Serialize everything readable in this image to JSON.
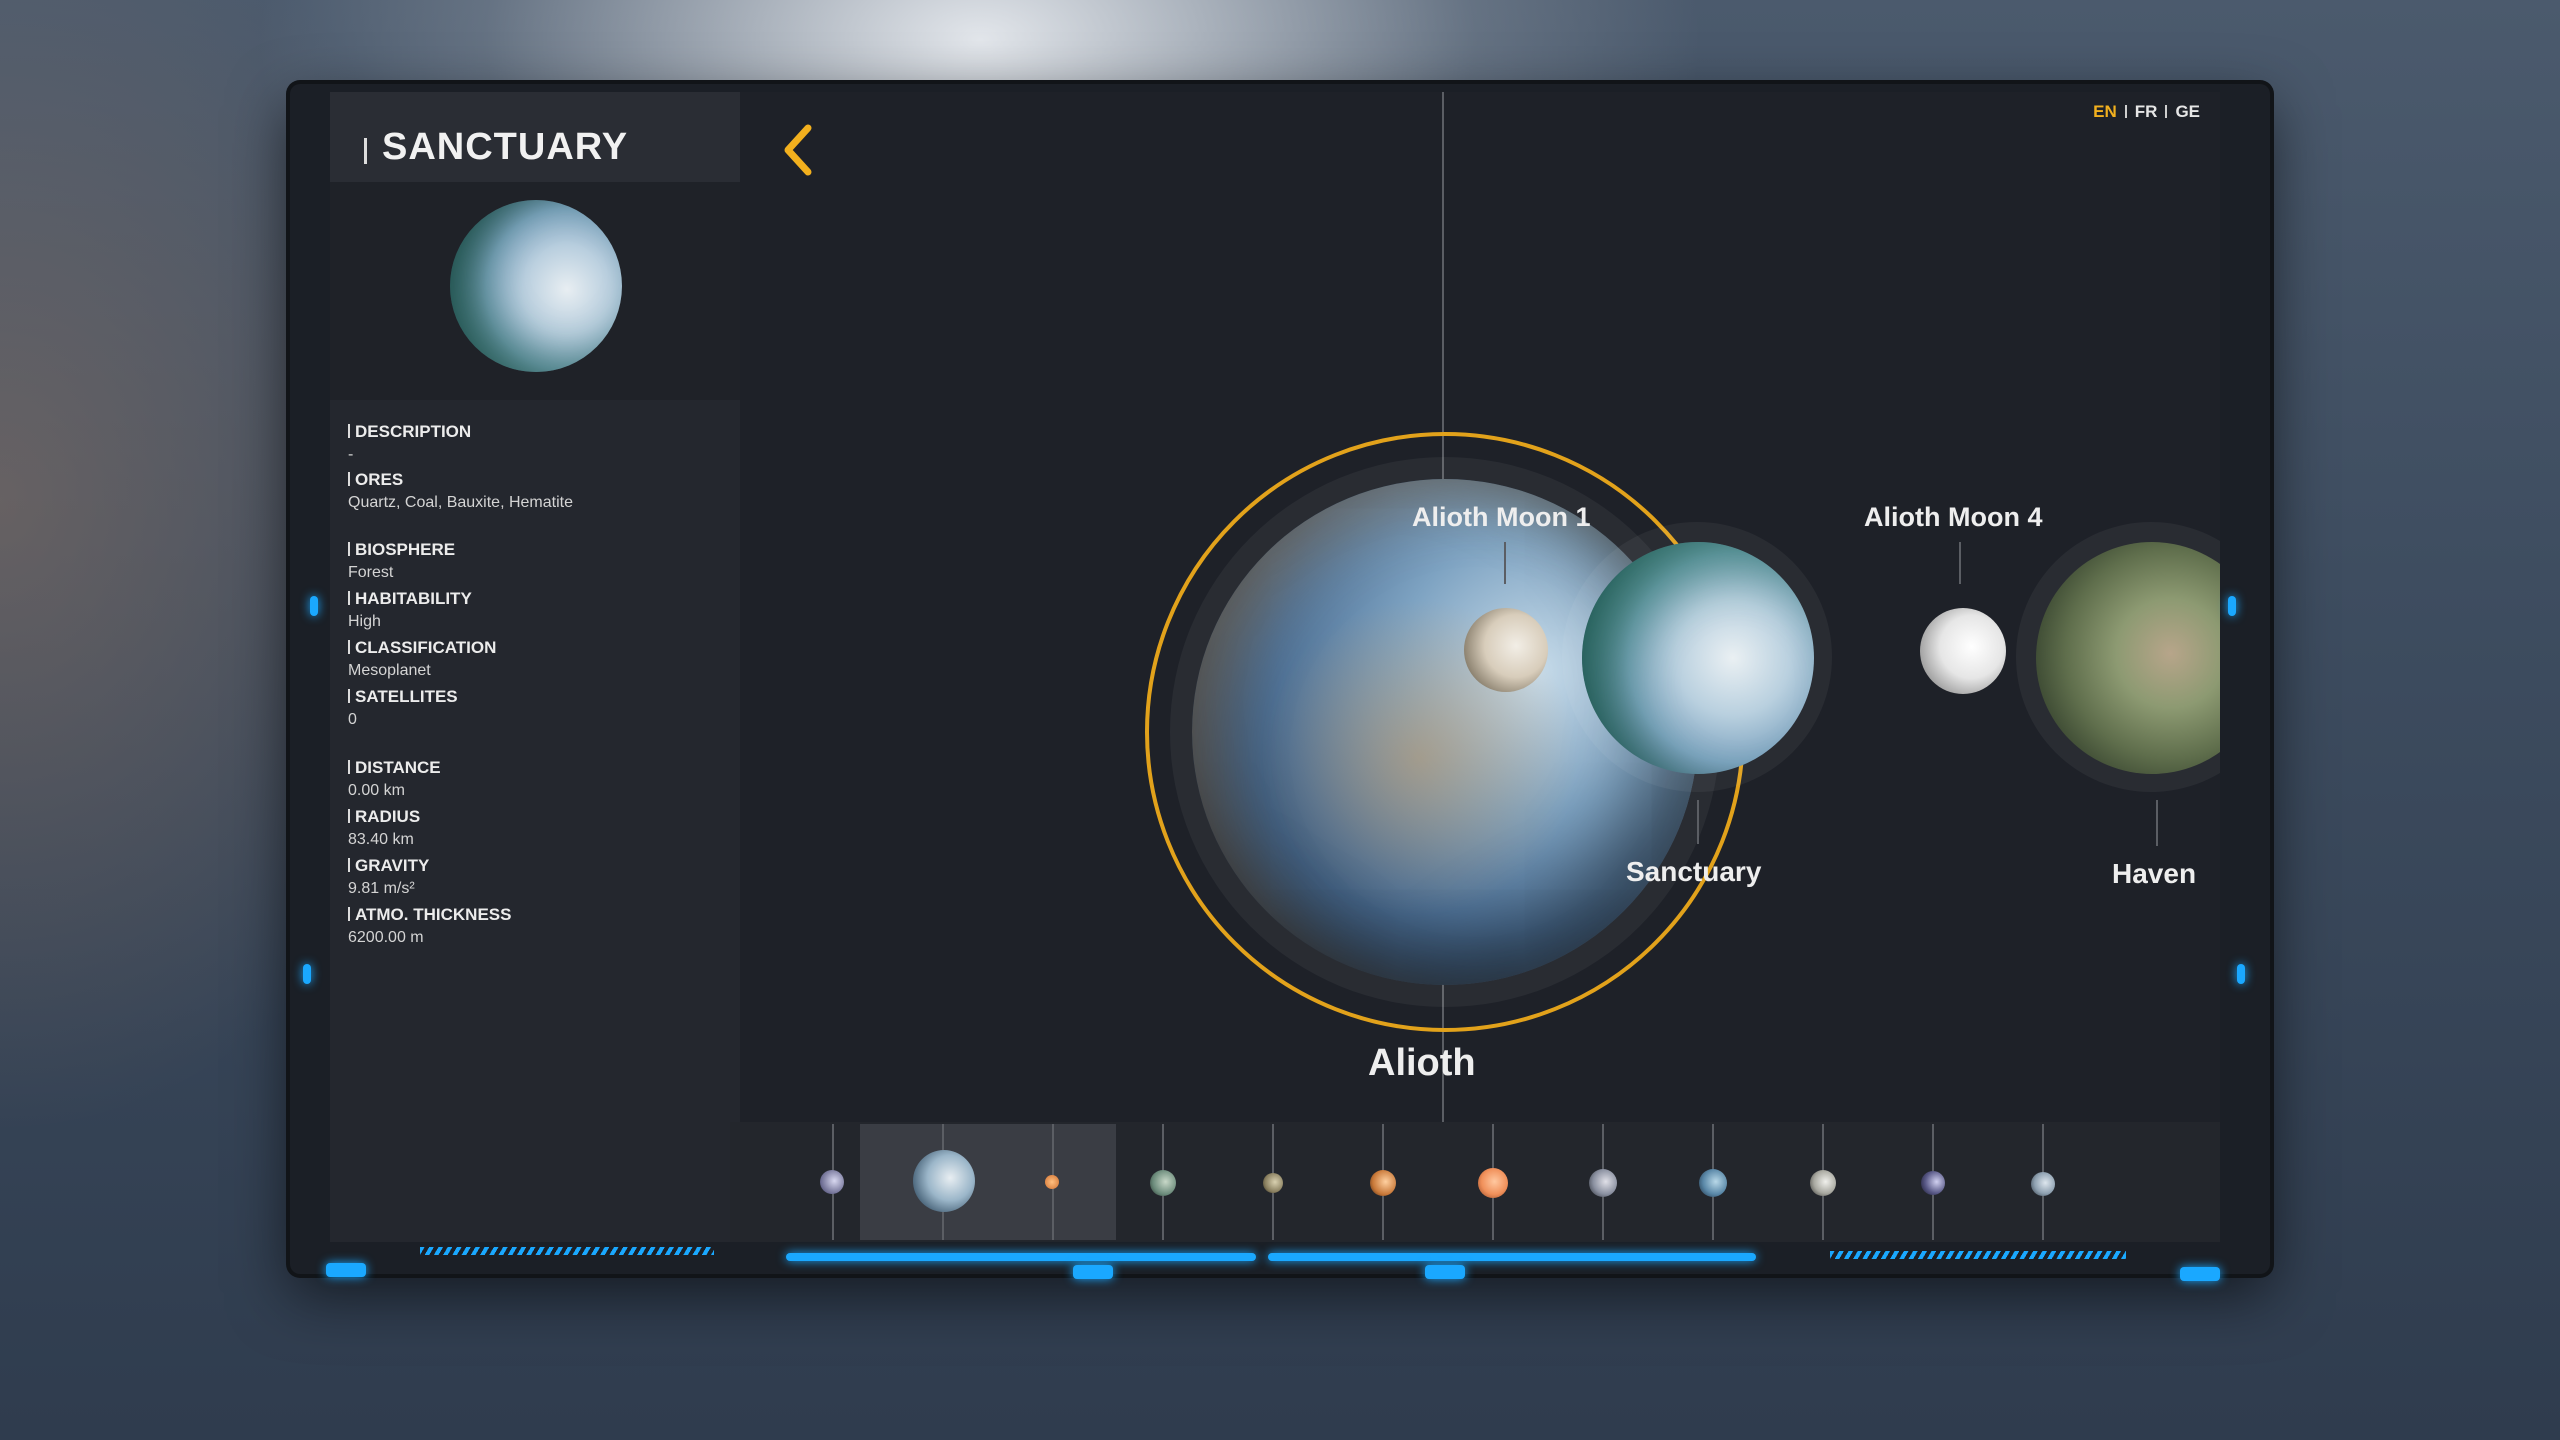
{
  "panel": {
    "title": "SANCTUARY",
    "fields": [
      {
        "label": "DESCRIPTION",
        "value": "-"
      },
      {
        "label": "ORES",
        "value": "Quartz, Coal, Bauxite, Hematite"
      },
      {
        "label": "BIOSPHERE",
        "value": "Forest"
      },
      {
        "label": "HABITABILITY",
        "value": "High"
      },
      {
        "label": "CLASSIFICATION",
        "value": "Mesoplanet"
      },
      {
        "label": "SATELLITES",
        "value": "0"
      },
      {
        "label": "DISTANCE",
        "value": "0.00 km"
      },
      {
        "label": "RADIUS",
        "value": "83.40 km"
      },
      {
        "label": "GRAVITY",
        "value": "9.81 m/s²"
      },
      {
        "label": "ATMO. THICKNESS",
        "value": "6200.00 m"
      }
    ]
  },
  "languages": [
    "EN",
    "FR",
    "GE"
  ],
  "active_language": "EN",
  "bodies": {
    "main": "Alioth",
    "moon1": "Alioth Moon 1",
    "moon4": "Alioth Moon 4",
    "sanctuary": "Sanctuary",
    "haven": "Haven"
  },
  "icons": {
    "back": "chevron-left-icon"
  },
  "colors": {
    "accent": "#f2b01e",
    "ring": "#e2a21b",
    "led": "#1aa8ff"
  }
}
